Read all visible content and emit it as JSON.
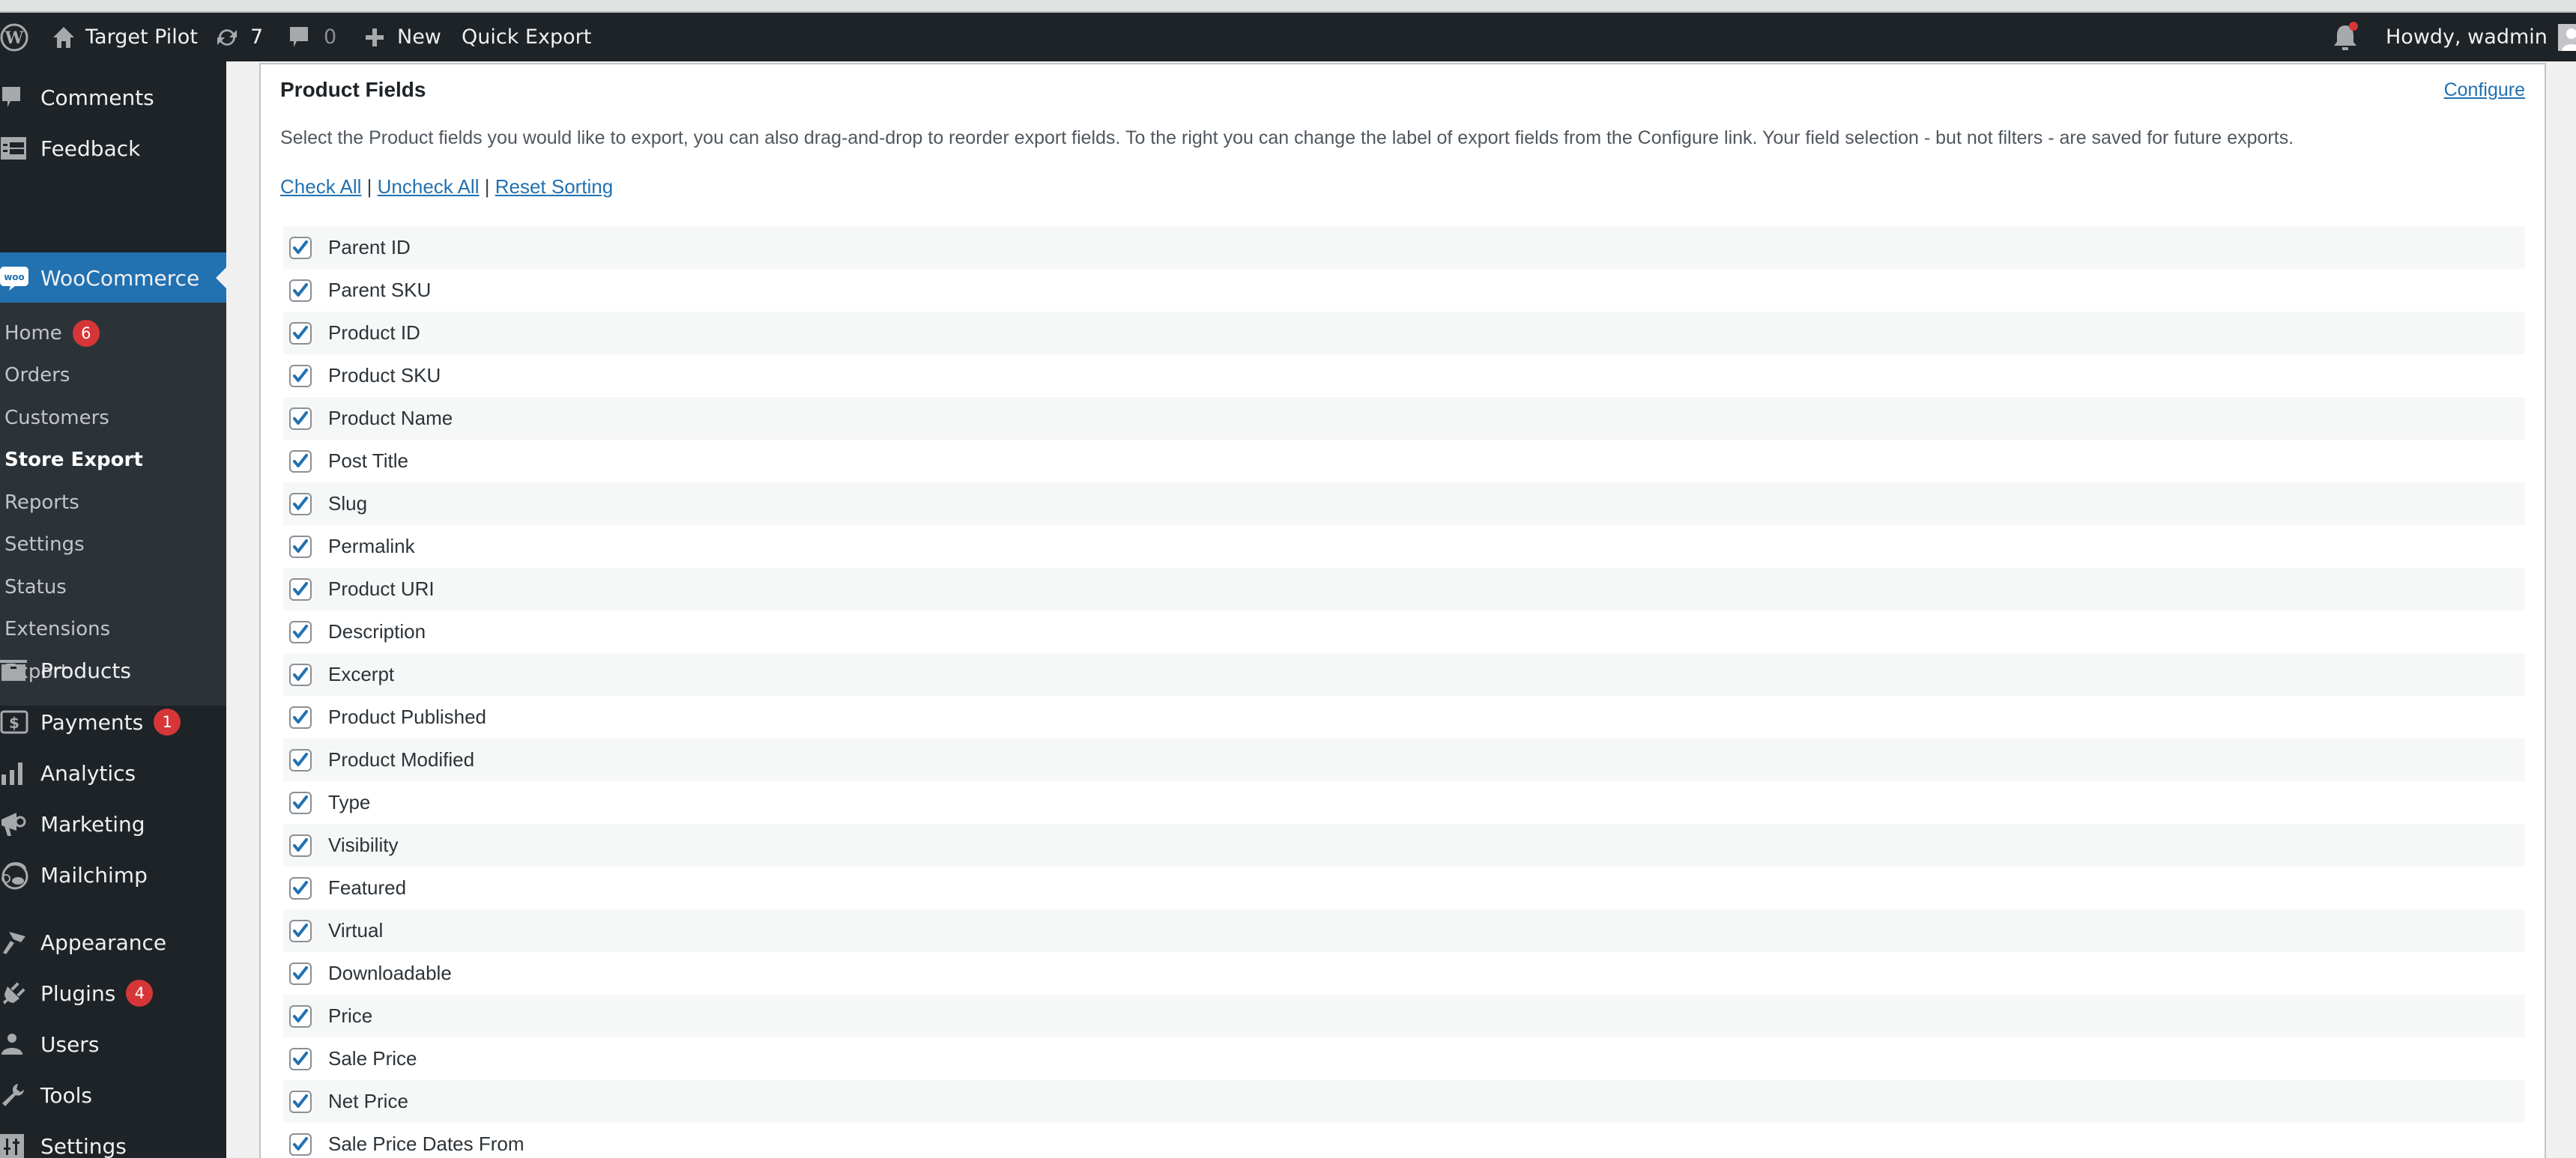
{
  "adminbar": {
    "site_name": "Target Pilot",
    "updates_count": "7",
    "comments_count": "0",
    "new_label": "New",
    "quick_export_label": "Quick Export",
    "greeting": "Howdy, wadmin"
  },
  "sidebar": {
    "top_items": [
      {
        "label": "Comments",
        "icon": "comment-icon"
      },
      {
        "label": "Feedback",
        "icon": "feedback-icon"
      }
    ],
    "woocommerce": {
      "label": "WooCommerce",
      "icon": "woo-icon"
    },
    "submenu": [
      {
        "label": "Home",
        "badge": "6"
      },
      {
        "label": "Orders"
      },
      {
        "label": "Customers"
      },
      {
        "label": "Store Export",
        "current": true
      },
      {
        "label": "Reports"
      },
      {
        "label": "Settings"
      },
      {
        "label": "Status"
      },
      {
        "label": "Extensions"
      },
      {
        "label": "Export"
      }
    ],
    "items": [
      {
        "label": "Products",
        "icon": "products-icon"
      },
      {
        "label": "Payments",
        "icon": "payments-icon",
        "badge": "1"
      },
      {
        "label": "Analytics",
        "icon": "analytics-icon"
      },
      {
        "label": "Marketing",
        "icon": "marketing-icon"
      },
      {
        "label": "Mailchimp",
        "icon": "mailchimp-icon"
      },
      {
        "label": "Appearance",
        "icon": "appearance-icon"
      },
      {
        "label": "Plugins",
        "icon": "plugins-icon",
        "badge": "4"
      },
      {
        "label": "Users",
        "icon": "users-icon"
      },
      {
        "label": "Tools",
        "icon": "tools-icon"
      },
      {
        "label": "Settings",
        "icon": "settings-icon"
      }
    ]
  },
  "panel": {
    "title": "Product Fields",
    "configure_label": "Configure",
    "description": "Select the Product fields you would like to export, you can also drag-and-drop to reorder export fields. To the right you can change the label of export fields from the Configure link. Your field selection - but not filters - are saved for future exports.",
    "check_all": "Check All",
    "uncheck_all": "Uncheck All",
    "reset_sorting": "Reset Sorting",
    "separator": "|",
    "fields": [
      {
        "label": "Parent ID",
        "checked": true
      },
      {
        "label": "Parent SKU",
        "checked": true
      },
      {
        "label": "Product ID",
        "checked": true
      },
      {
        "label": "Product SKU",
        "checked": true
      },
      {
        "label": "Product Name",
        "checked": true
      },
      {
        "label": "Post Title",
        "checked": true
      },
      {
        "label": "Slug",
        "checked": true
      },
      {
        "label": "Permalink",
        "checked": true
      },
      {
        "label": "Product URI",
        "checked": true
      },
      {
        "label": "Description",
        "checked": true
      },
      {
        "label": "Excerpt",
        "checked": true
      },
      {
        "label": "Product Published",
        "checked": true
      },
      {
        "label": "Product Modified",
        "checked": true
      },
      {
        "label": "Type",
        "checked": true
      },
      {
        "label": "Visibility",
        "checked": true
      },
      {
        "label": "Featured",
        "checked": true
      },
      {
        "label": "Virtual",
        "checked": true
      },
      {
        "label": "Downloadable",
        "checked": true
      },
      {
        "label": "Price",
        "checked": true
      },
      {
        "label": "Sale Price",
        "checked": true
      },
      {
        "label": "Net Price",
        "checked": true
      },
      {
        "label": "Sale Price Dates From",
        "checked": true
      }
    ]
  },
  "colors": {
    "adminbar_bg": "#1d2327",
    "active_menu": "#2271b1",
    "badge": "#d63638",
    "link": "#2271b1",
    "checkmark": "#2271b1"
  }
}
